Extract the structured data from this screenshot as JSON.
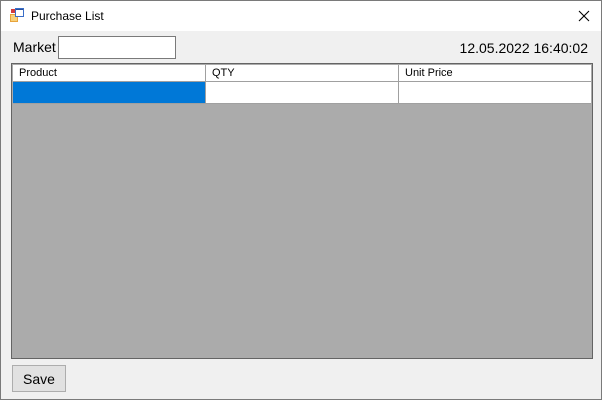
{
  "window": {
    "title": "Purchase List",
    "icon": "windows-form-icon",
    "close_icon": "close-icon"
  },
  "form": {
    "market_label": "Market",
    "market_value": "",
    "datetime": "12.05.2022 16:40:02"
  },
  "grid": {
    "columns": [
      "Product",
      "QTY",
      "Unit Price"
    ],
    "rows": [
      [
        "",
        "",
        ""
      ]
    ],
    "selected_cell_color": "#0078d7",
    "background_color": "#ababab"
  },
  "actions": {
    "save_label": "Save"
  }
}
